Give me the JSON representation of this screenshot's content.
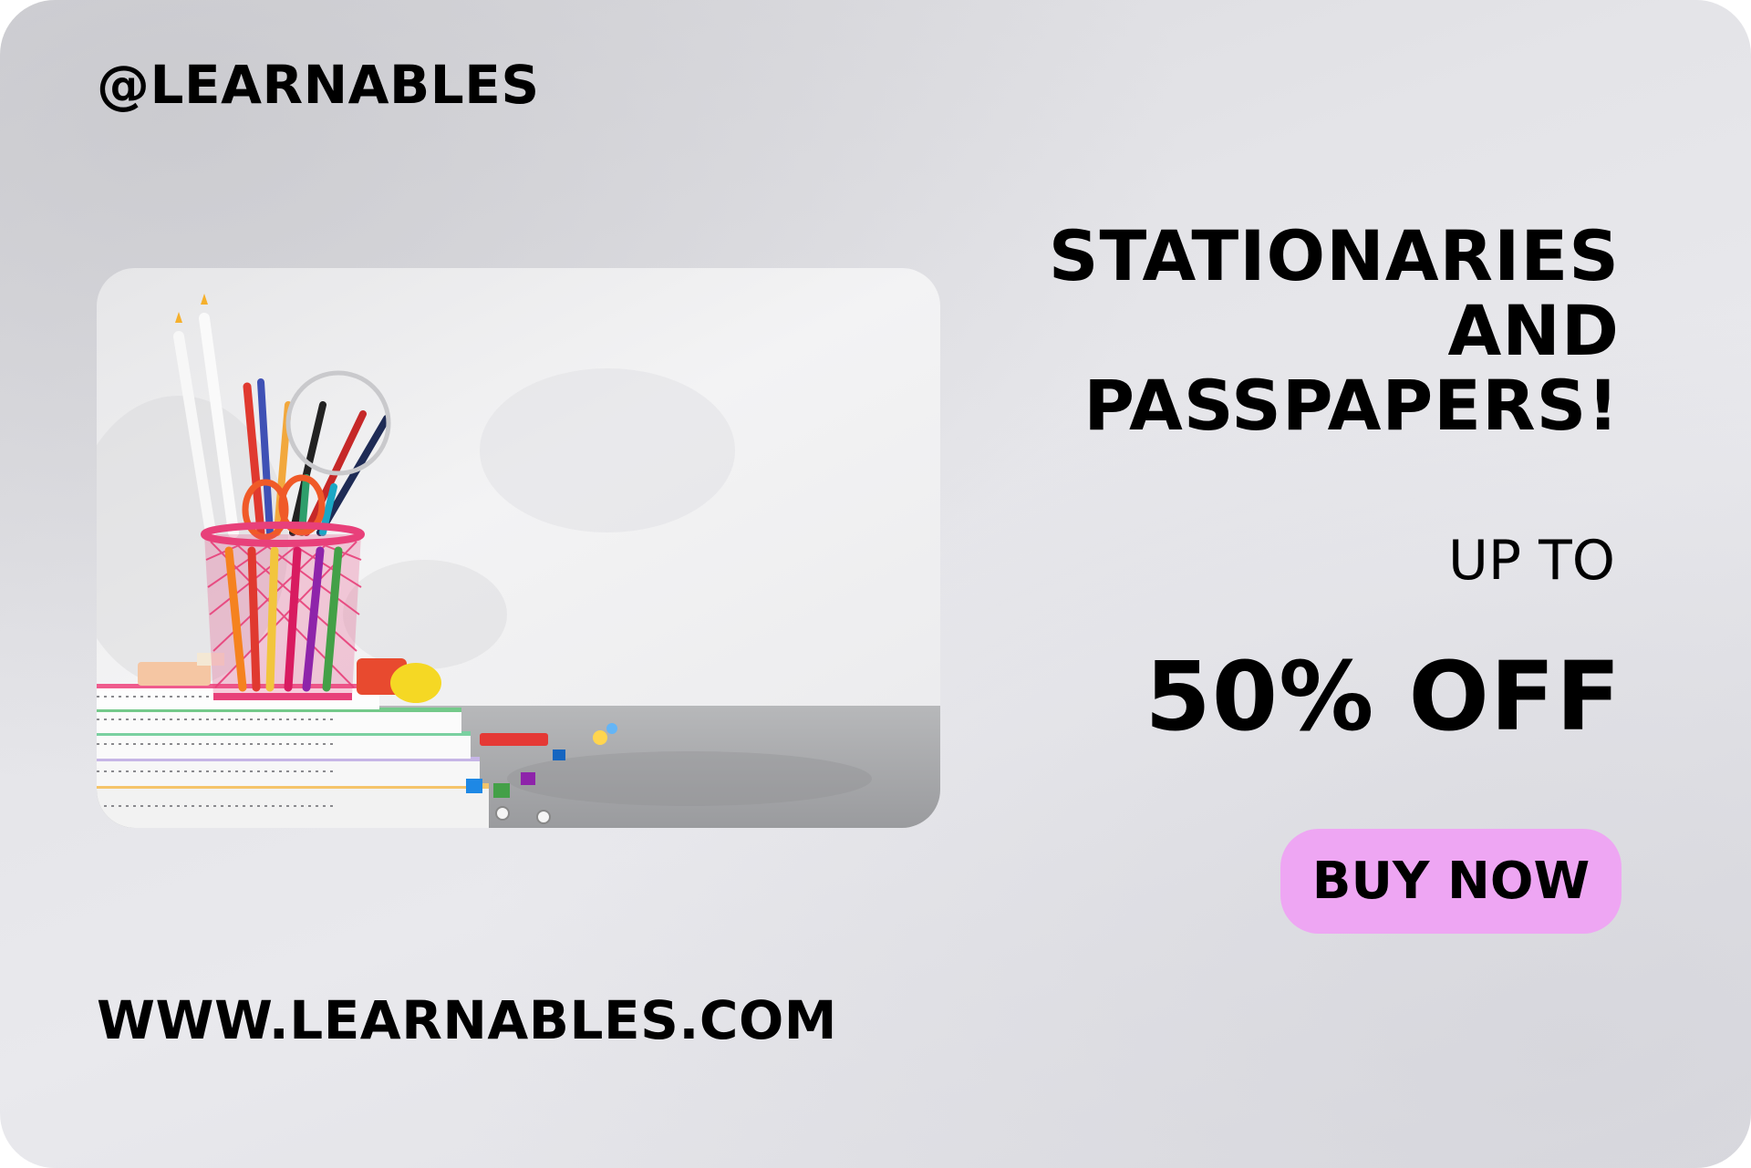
{
  "brand": {
    "handle": "@LEARNABLES",
    "website": "WWW.LEARNABLES.COM"
  },
  "promo": {
    "headline_lines": [
      "STATIONARIES",
      "AND",
      "PASSPAPERS!"
    ],
    "upto": "UP TO",
    "discount": "50% OFF",
    "cta_label": "BUY NOW"
  },
  "photo": {
    "subject": "pencil cup with colored pencils, scissors and stacked spiral notebooks"
  },
  "colors": {
    "cta_background": "#eea6f3",
    "text": "#000000",
    "pencil_cup": "#e8407a"
  }
}
